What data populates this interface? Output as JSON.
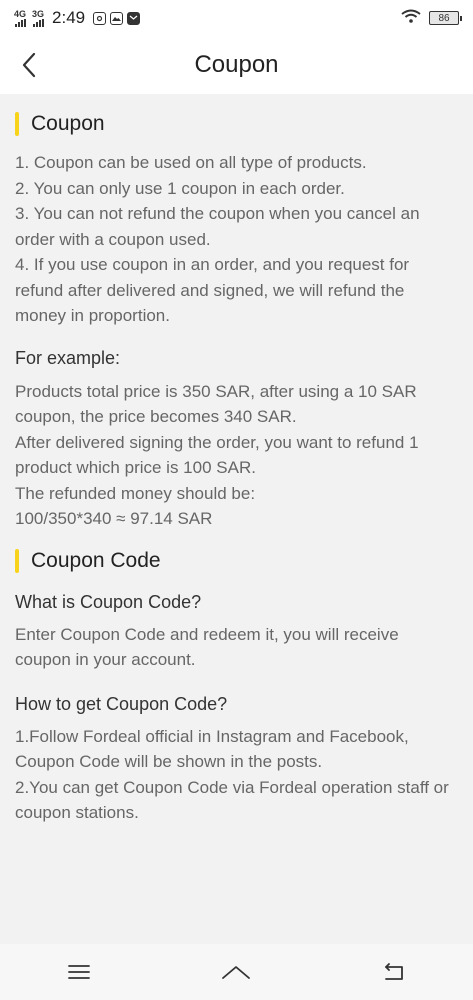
{
  "status_bar": {
    "network_1": "4G",
    "network_2": "3G",
    "time": "2:49",
    "battery": "86",
    "icons": [
      "instagram-icon",
      "gallery-icon",
      "mail-icon",
      "wifi-icon",
      "battery-icon"
    ]
  },
  "header": {
    "title": "Coupon",
    "back_icon": "chevron-left-icon"
  },
  "section1": {
    "title": "Coupon",
    "rules": [
      "1. Coupon can be used on all type of products.",
      "2. You can only use 1 coupon in each order.",
      "3. You can not refund the coupon when you cancel an order with a coupon used.",
      "4. If you use coupon in an order, and you request for refund after delivered and signed, we will refund the money in proportion."
    ],
    "example_title": "For example:",
    "example_lines": [
      "Products total price is 350 SAR, after using a 10 SAR coupon, the price becomes 340 SAR.",
      "After delivered signing the order, you want to refund 1 product which price is 100 SAR.",
      "The refunded money should be:",
      "100/350*340 ≈ 97.14 SAR"
    ]
  },
  "section2": {
    "title": "Coupon Code",
    "q1": "What is Coupon Code?",
    "a1": "Enter Coupon Code and redeem it, you will receive coupon in your account.",
    "q2": "How to get Coupon Code?",
    "a2_lines": [
      "1.Follow Fordeal official in Instagram and Facebook, Coupon Code will be shown in the posts.",
      "2.You can get Coupon Code via Fordeal operation staff or coupon stations."
    ]
  },
  "nav_bar": {
    "icons": [
      "menu-icon",
      "home-icon",
      "back-icon"
    ]
  },
  "colors": {
    "accent": "#f7d31b",
    "background": "#f2f2f2"
  }
}
